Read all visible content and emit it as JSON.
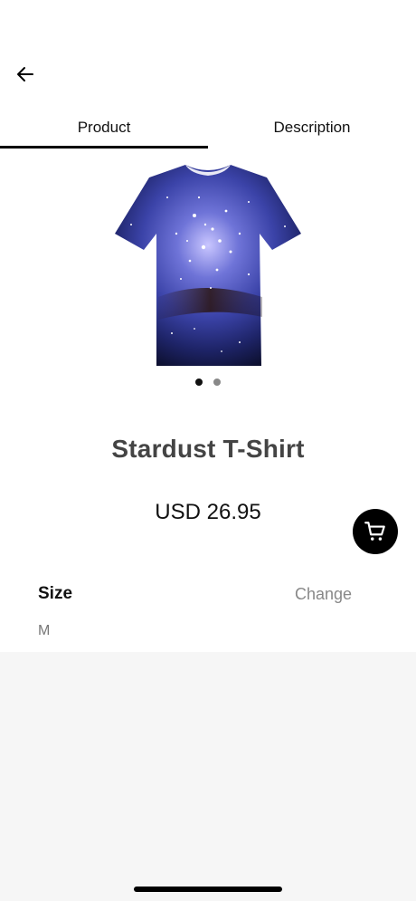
{
  "header": {
    "back_icon": "arrow-left-icon"
  },
  "tabs": [
    {
      "label": "Product",
      "active": true
    },
    {
      "label": "Description",
      "active": false
    }
  ],
  "product": {
    "image_alt": "Galaxy print t-shirt",
    "title": "Stardust T-Shirt",
    "price": "USD 26.95",
    "image_count": 2,
    "active_image_index": 0
  },
  "size": {
    "label": "Size",
    "change_label": "Change",
    "value": "M"
  },
  "cart_button": {
    "icon": "cart-icon"
  },
  "colors": {
    "accent": "#000000",
    "muted": "#888888",
    "bottom_bg": "#f6f6f6"
  }
}
